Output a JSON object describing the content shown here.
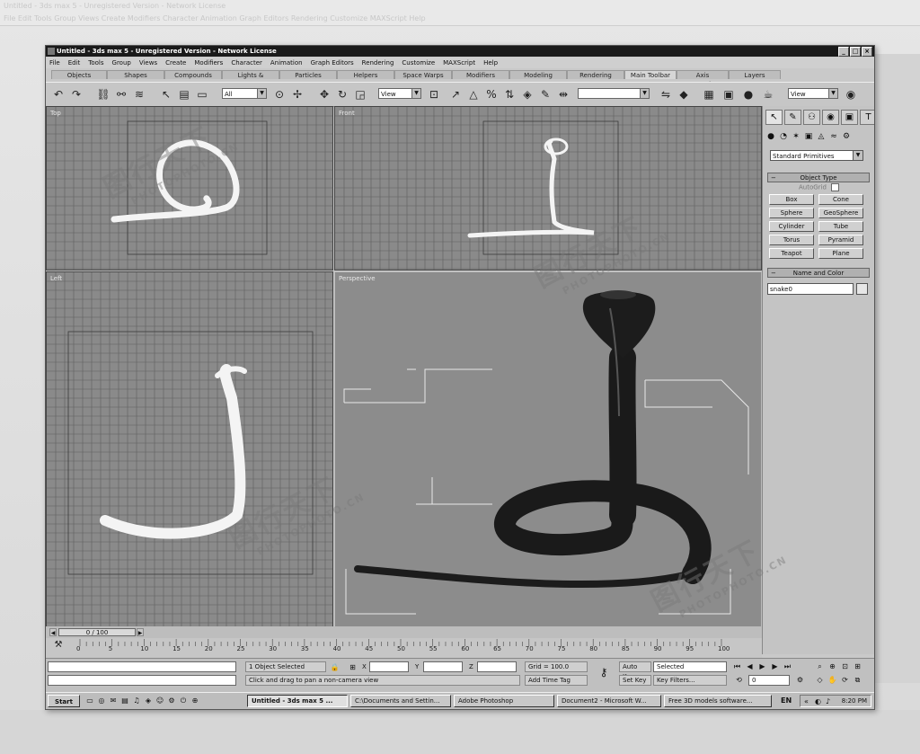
{
  "ghost": {
    "title": "Untitled - 3ds max 5 - Unregistered Version - Network License",
    "menu": "File  Edit  Tools  Group  Views  Create  Modifiers  Character  Animation  Graph Editors  Rendering  Customize  MAXScript  Help"
  },
  "window": {
    "title": "Untitled - 3ds max 5 - Unregistered Version - Network License",
    "controls": [
      "_",
      "□",
      "×"
    ]
  },
  "menu": [
    "File",
    "Edit",
    "Tools",
    "Group",
    "Views",
    "Create",
    "Modifiers",
    "Character",
    "Animation",
    "Graph Editors",
    "Rendering",
    "Customize",
    "MAXScript",
    "Help"
  ],
  "tabs": [
    "Objects",
    "Shapes",
    "Compounds",
    "Lights & Cameras",
    "Particles",
    "Helpers",
    "Space Warps",
    "Modifiers",
    "Modeling",
    "Rendering",
    "Main Toolbar",
    "Axis Constraints",
    "Layers"
  ],
  "active_tab": "Main Toolbar",
  "toolbar": {
    "selection_filter": "All",
    "ref_coord": "View",
    "named_selection": "",
    "render_type": "View"
  },
  "viewports": {
    "top": "Top",
    "front": "Front",
    "left": "Left",
    "perspective": "Perspective"
  },
  "command_panel": {
    "category": "Standard Primitives",
    "object_type_title": "Object Type",
    "autogrid": "AutoGrid",
    "buttons": [
      "Box",
      "Cone",
      "Sphere",
      "GeoSphere",
      "Cylinder",
      "Tube",
      "Torus",
      "Pyramid",
      "Teapot",
      "Plane"
    ],
    "name_color_title": "Name and Color",
    "object_name": "snake0"
  },
  "timeline": {
    "frame_display": "0 / 100",
    "ticks": [
      "0",
      "5",
      "10",
      "15",
      "20",
      "25",
      "30",
      "35",
      "40",
      "45",
      "50",
      "55",
      "60",
      "65",
      "70",
      "75",
      "80",
      "85",
      "90",
      "95",
      "100"
    ]
  },
  "status": {
    "selection": "1 Object Selected",
    "prompt": "Click and drag to pan a non-camera view",
    "x_label": "X",
    "y_label": "Y",
    "z_label": "Z",
    "grid": "Grid = 100.0",
    "add_time_tag": "Add Time Tag",
    "auto_key": "Auto Key",
    "set_key": "Set Key",
    "key_mode": "Selected",
    "key_filters": "Key Filters...",
    "current_frame": "0"
  },
  "taskbar": {
    "start": "Start",
    "tasks": [
      "Untitled - 3ds max 5 ...",
      "C:\\Documents and Settin...",
      "Adobe Photoshop",
      "Document2 - Microsoft W...",
      "Free 3D models software..."
    ],
    "lang": "EN",
    "time": "8:20 PM"
  },
  "watermark": {
    "chars": "图行天下",
    "url": "PHOTOPHOTO.CN"
  },
  "colors": {
    "viewport_bg": "#8a8a8a",
    "grid_line": "#5e5e5e",
    "snake_dark": "#1c1c1c",
    "wire": "#f4f4f4"
  }
}
